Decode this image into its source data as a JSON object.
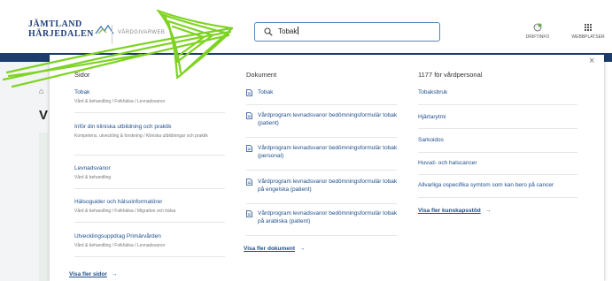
{
  "header": {
    "logo_line1": "JÄMTLAND",
    "logo_line2": "HÄRJEDALEN",
    "site_name": "VÅRDGIVARWEB",
    "search_value": "Tobak",
    "tools": {
      "driftinfo": "DRIFTINFO",
      "webbplatser": "WEBBPLATSER"
    }
  },
  "backdrop": {
    "home_glyph": "⌂",
    "heading_initial": "V"
  },
  "panel": {
    "close_glyph": "×",
    "pages": {
      "heading": "Sidor",
      "items": [
        {
          "title": "Tobak",
          "sub": "Vård & behandling / Folkhälsa / Levnadsvanor"
        },
        {
          "title": "Inför din kliniska utbildning och praktik",
          "sub": "Kompetens, utveckling & forskning / Kliniska utbildningar och praktik"
        },
        {
          "title": "Levnadsvanor",
          "sub": "Vård & behandling"
        },
        {
          "title": "Hälsoguider och hälsoinformatörer",
          "sub": "Vård & behandling / Folkhälsa / Migration och hälsa"
        },
        {
          "title": "Utvecklingsuppdrag Primärvården",
          "sub": "Vård & behandling / Folkhälsa / Levnadsvanor"
        }
      ],
      "more": "Visa fler sidor"
    },
    "documents": {
      "heading": "Dokument",
      "items": [
        {
          "title": "Tobak"
        },
        {
          "title": "Vårdprogram levnadsvanor bedömningsformulär tobak (patient)"
        },
        {
          "title": "Vårdprogram levnadsvanor bedömningsformulär tobak (personal)"
        },
        {
          "title": "Vårdprogram levnadsvanor bedömningsformulär tobak på engelska (patient)"
        },
        {
          "title": "Vårdprogram levnadsvanor bedömningsformulär tobak på arabiska (patient)"
        }
      ],
      "more": "Visa fler dokument"
    },
    "knowledge": {
      "heading": "1177 för vårdpersonal",
      "items": [
        {
          "title": "Tobaksbruk"
        },
        {
          "title": "Hjärtarytmi"
        },
        {
          "title": "Sarkoidos"
        },
        {
          "title": "Huvud- och halscancer"
        },
        {
          "title": "Allvarliga ospecifika symtom som kan bero på cancer"
        }
      ],
      "more": "Visa fler kunskapsstöd"
    },
    "arrow_glyph": "→"
  },
  "colors": {
    "link": "#1f4e8c",
    "brand": "#1f3f7a",
    "backdrop": "#1c3d6b",
    "annotation": "#7ed321"
  }
}
